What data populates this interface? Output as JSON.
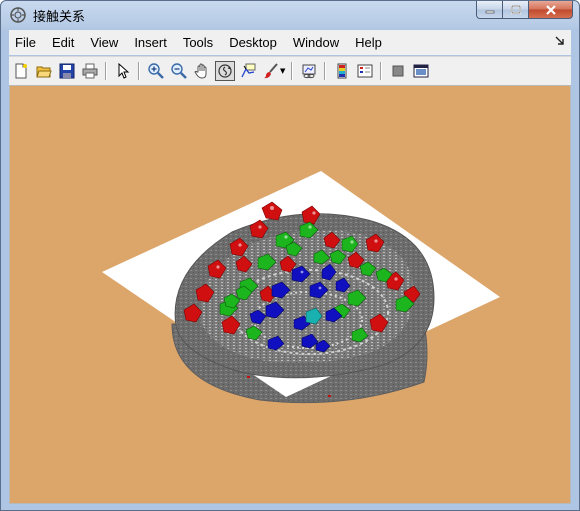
{
  "window": {
    "title": "接触关系"
  },
  "menu": {
    "items": [
      {
        "label": "File",
        "name": "menu-file"
      },
      {
        "label": "Edit",
        "name": "menu-edit"
      },
      {
        "label": "View",
        "name": "menu-view"
      },
      {
        "label": "Insert",
        "name": "menu-insert"
      },
      {
        "label": "Tools",
        "name": "menu-tools"
      },
      {
        "label": "Desktop",
        "name": "menu-desktop"
      },
      {
        "label": "Window",
        "name": "menu-window"
      },
      {
        "label": "Help",
        "name": "menu-help"
      }
    ]
  },
  "toolbar": {
    "buttons": [
      "new-figure-icon",
      "open-file-icon",
      "save-icon",
      "print-icon",
      "pointer-icon",
      "zoom-in-icon",
      "zoom-out-icon",
      "pan-hand-icon",
      "rotate-3d-icon",
      "data-cursor-icon",
      "brush-icon",
      "link-plot-icon",
      "colorbar-icon",
      "legend-icon",
      "hide-plot-tools-icon",
      "show-plot-tools-icon"
    ]
  },
  "colors": {
    "background": "#dca66b",
    "plane": "#ffffff",
    "bowl": "#6e6e6e",
    "particle_red": "#d01010",
    "particle_green": "#1db51d",
    "particle_blue": "#1010c0",
    "particle_cyan": "#19b0b0"
  }
}
